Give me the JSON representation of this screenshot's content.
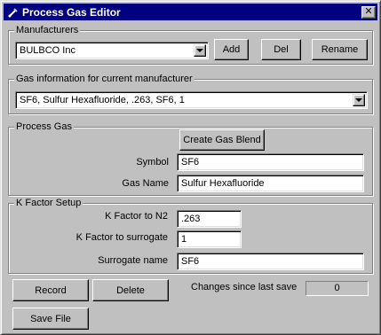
{
  "window": {
    "title": "Process Gas Editor",
    "close_label": "✕"
  },
  "manufacturers": {
    "group_label": "Manufacturers",
    "selected": "BULBCO Inc",
    "add_label": "Add",
    "del_label": "Del",
    "rename_label": "Rename"
  },
  "gas_info": {
    "group_label": "Gas information for current manufacturer",
    "selected": "SF6, Sulfur Hexafluoride,  .263, SF6,  1"
  },
  "process_gas": {
    "group_label": "Process Gas",
    "create_blend_label": "Create Gas Blend",
    "symbol_label": "Symbol",
    "symbol_value": "SF6",
    "gas_name_label": "Gas Name",
    "gas_name_value": "Sulfur Hexafluoride"
  },
  "k_factor": {
    "group_label": "K Factor Setup",
    "to_n2_label": "K Factor to N2",
    "to_n2_value": ".263",
    "to_surrogate_label": "K Factor to surrogate",
    "to_surrogate_value": "1",
    "surrogate_name_label": "Surrogate name",
    "surrogate_name_value": "SF6"
  },
  "actions": {
    "record_label": "Record",
    "delete_label": "Delete",
    "save_file_label": "Save File",
    "changes_label": "Changes since last save",
    "changes_value": "0"
  },
  "icons": {
    "title": "gas-cylinder-icon",
    "dropdown": "chevron-down-icon"
  }
}
